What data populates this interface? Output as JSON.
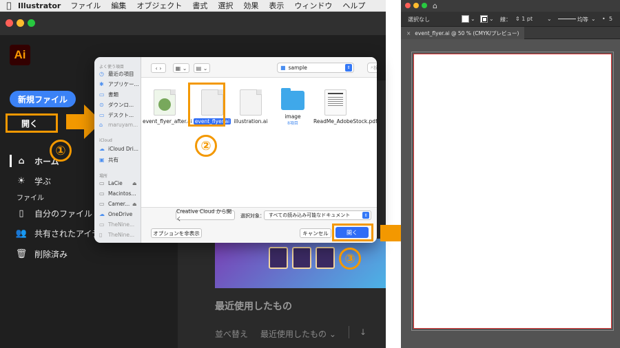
{
  "menubar": {
    "app_name": "Illustrator",
    "items": [
      "ファイル",
      "編集",
      "オブジェクト",
      "書式",
      "選択",
      "効果",
      "表示",
      "ウィンドウ",
      "ヘルプ"
    ]
  },
  "home": {
    "logo": "Ai",
    "new_file": "新規ファイル",
    "open": "開く",
    "nav": {
      "home": "ホーム",
      "learn": "学ぶ",
      "files_header": "ファイル",
      "your_files": "自分のファイル",
      "shared": "共有されたアイテ",
      "deleted": "削除済み"
    },
    "recent_title": "最近使用したもの",
    "sort_label": "並べ替え",
    "sort_value": "最近使用したもの"
  },
  "callouts": {
    "one": "①",
    "two": "②",
    "three": "③"
  },
  "dialog": {
    "sidebar": {
      "favorites_header": "よく使う項目",
      "favorites": [
        "最近の項目",
        "アプリケー...",
        "書類",
        "ダウンロ...",
        "デスクト..."
      ],
      "dimmed_item": "maruyam...",
      "icloud_header": "iCloud",
      "icloud": [
        "iCloud Dri...",
        "共有"
      ],
      "locations_header": "場所",
      "locations": [
        "LaCie",
        "Macintos...",
        "Camer...",
        "OneDrive",
        "TheNine...",
        "TheNine..."
      ]
    },
    "folder": "sample",
    "search_placeholder": "検索",
    "files": [
      {
        "name": "event_flyer_after.ai"
      },
      {
        "name": "event_flyer.ai"
      },
      {
        "name": "illustration.ai"
      },
      {
        "name": "image",
        "sub": "8項目"
      },
      {
        "name": "ReadMe_AdobeStock.pdf"
      }
    ],
    "cc_button": "Creative Cloud から開く",
    "filter_label": "選択対象：",
    "filter_value": "すべての読み込み可能なドキュメント",
    "options_button": "オプションを非表示",
    "cancel_button": "キャンセル",
    "open_button": "開く"
  },
  "document": {
    "selection": "選択なし",
    "stroke_label": "線：",
    "stroke_value": "1 pt",
    "profile": "均等",
    "brush_size": "5",
    "tab": "event_flyer.ai @ 50 % (CMYK/プレビュー)"
  },
  "colors": {
    "accent_orange": "#f39800",
    "ai_blue": "#3b82f6",
    "mac_blue": "#2f6df6"
  }
}
